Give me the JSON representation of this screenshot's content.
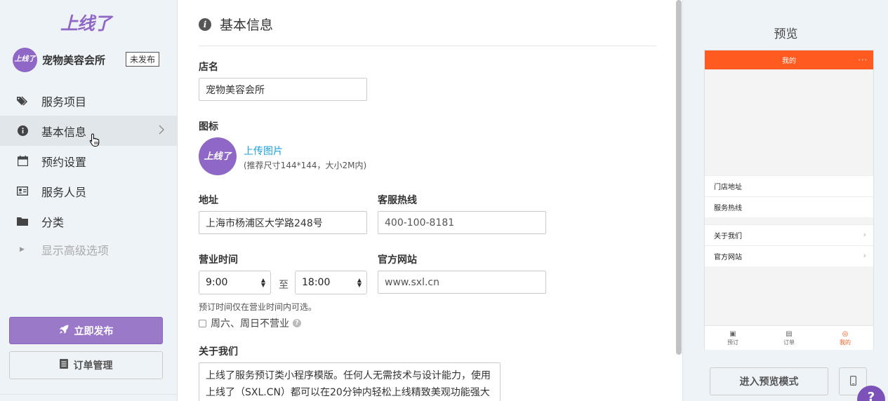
{
  "brand": {
    "logo_text": "上线了",
    "accent": "#8f67c6"
  },
  "store": {
    "name": "宠物美容会所",
    "status_badge": "未发布",
    "avatar_text": "上线了"
  },
  "sidebar": {
    "items": [
      {
        "label": "服务项目",
        "icon": "tags-icon"
      },
      {
        "label": "基本信息",
        "icon": "info-icon",
        "active": true
      },
      {
        "label": "预约设置",
        "icon": "calendar-icon"
      },
      {
        "label": "服务人员",
        "icon": "id-card-icon"
      },
      {
        "label": "分类",
        "icon": "folder-icon"
      }
    ],
    "advanced_label": "显示高级选项",
    "publish_label": "立即发布",
    "orders_label": "订单管理"
  },
  "form": {
    "section_title": "基本信息",
    "store_name_label": "店名",
    "store_name_value": "宠物美容会所",
    "icon_label": "图标",
    "upload_label": "上传图片",
    "upload_hint": "(推荐尺寸144*144，大小2M内)",
    "address_label": "地址",
    "address_value": "上海市杨浦区大学路248号",
    "hotline_label": "客服热线",
    "hotline_value": "400-100-8181",
    "hours_label": "营业时间",
    "open_time": "9:00",
    "to_label": "至",
    "close_time": "18:00",
    "website_label": "官方网站",
    "website_value": "www.sxl.cn",
    "hours_help": "预订时间仅在营业时间内可选。",
    "weekend_label": "周六、周日不营业",
    "about_label": "关于我们",
    "about_value": "上线了服务预订类小程序模版。任何人无需技术与设计能力，使用上线了（SXL.CN）都可以在20分钟内轻松上线精致美观功能强大的"
  },
  "preview": {
    "title": "预览",
    "phone_title": "我的",
    "rows_group1": [
      "门店地址",
      "服务热线"
    ],
    "rows_group2": [
      "关于我们",
      "官方网站"
    ],
    "tabs": [
      "预订",
      "订单",
      "我的"
    ],
    "enter_preview_label": "进入预览模式",
    "phone_accent": "#ff5a1f"
  },
  "help_bubble": "?"
}
